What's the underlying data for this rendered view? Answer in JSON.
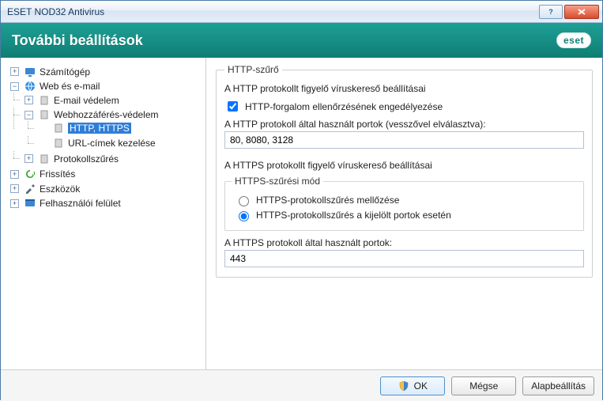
{
  "window": {
    "title": "ESET NOD32 Antivirus"
  },
  "header": {
    "title": "További beállítások",
    "brand": "eset"
  },
  "tree": {
    "computer": "Számítógép",
    "web_email": "Web és e-mail",
    "email_protection": "E-mail védelem",
    "web_access": "Webhozzáférés-védelem",
    "http_https": "HTTP, HTTPS",
    "url_mgmt": "URL-címek kezelése",
    "protocol_filtering": "Protokollszűrés",
    "updates": "Frissítés",
    "tools": "Eszközök",
    "ui": "Felhasználói felület"
  },
  "main": {
    "fieldset_title": "HTTP-szűrő",
    "http_section": "A HTTP protokollt figyelő víruskereső beállításai",
    "http_checkbox": "HTTP-forgalom ellenőrzésének engedélyezése",
    "http_ports_label": "A HTTP protokoll által használt portok (vesszővel elválasztva):",
    "http_ports_value": "80, 8080, 3128",
    "https_section": "A HTTPS protokollt figyelő víruskereső beállításai",
    "https_mode_legend": "HTTPS-szűrési mód",
    "https_mode_none": "HTTPS-protokollszűrés mellőzése",
    "https_mode_selected": "HTTPS-protokollszűrés a kijelölt portok esetén",
    "https_ports_label": "A HTTPS protokoll által használt portok:",
    "https_ports_value": "443"
  },
  "footer": {
    "ok": "OK",
    "cancel": "Mégse",
    "default": "Alapbeállítás"
  }
}
